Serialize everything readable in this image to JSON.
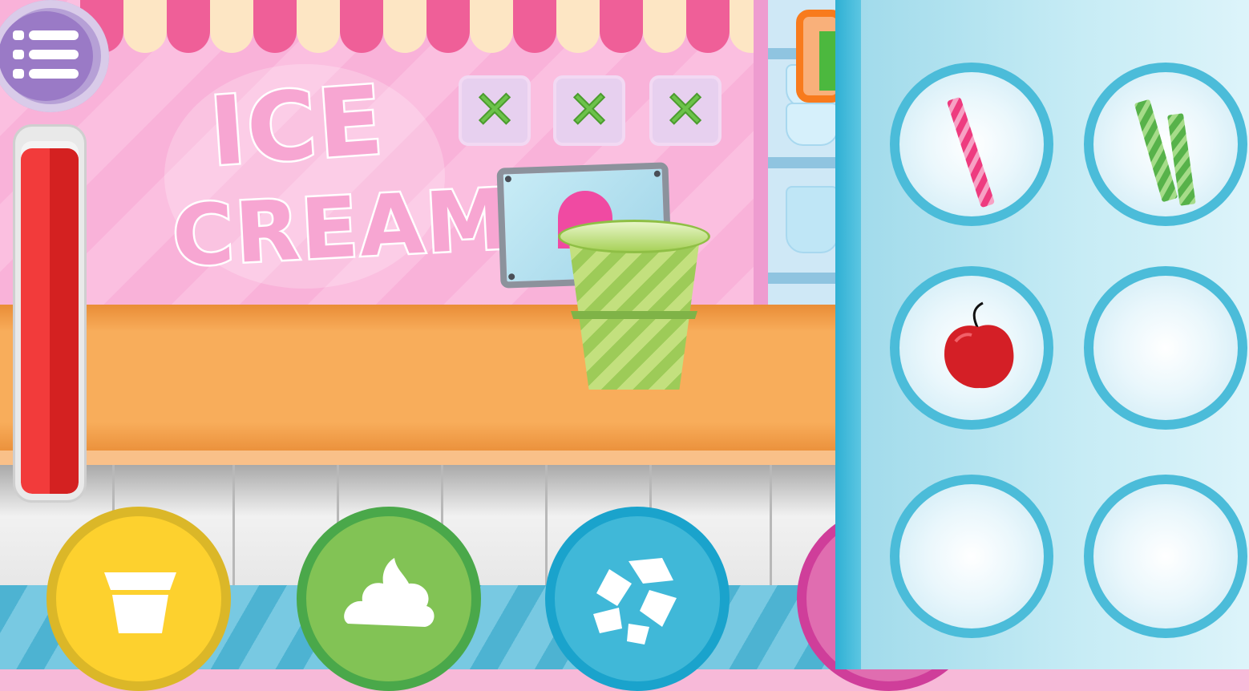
{
  "sign": {
    "line1": "ICE",
    "line2": "CREAM"
  },
  "order_slots": [
    {
      "mark": "✕"
    },
    {
      "mark": "✕"
    },
    {
      "mark": "✕"
    }
  ],
  "timer": {
    "level": 0.98,
    "color": "#e02a2a"
  },
  "tools": [
    {
      "name": "cup",
      "color": "#fdd12e"
    },
    {
      "name": "cream",
      "color": "#82c355"
    },
    {
      "name": "topping",
      "color": "#40b8d8"
    },
    {
      "name": "extra",
      "color": "#e06db0"
    }
  ],
  "toppings": [
    {
      "name": "pink-straw-icon"
    },
    {
      "name": "green-wafer-icon"
    },
    {
      "name": "cherry-icon"
    },
    {
      "name": "empty"
    },
    {
      "name": "empty"
    },
    {
      "name": "empty"
    }
  ],
  "colors": {
    "awning_pink": "#ef5f98",
    "awning_cream": "#fde6c4",
    "panel_ring": "#4bbcd9"
  }
}
